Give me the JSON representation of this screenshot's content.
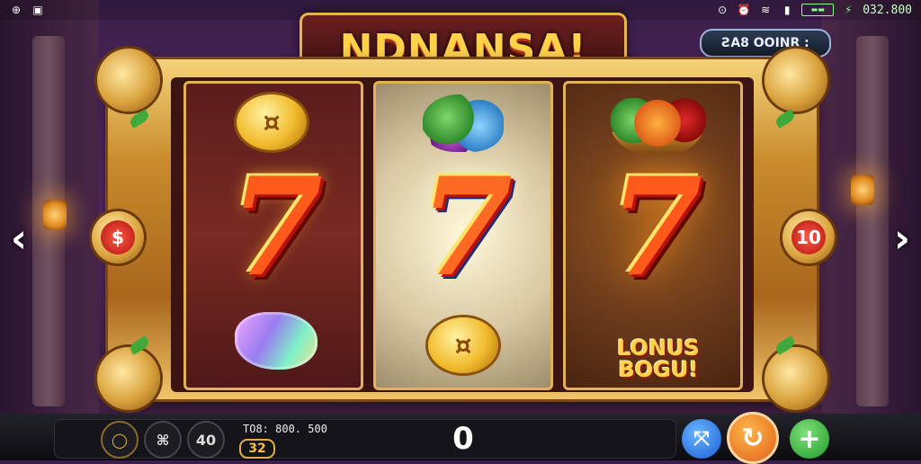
{
  "status_bar": {
    "left_icons": [
      "network-icon",
      "image-icon"
    ],
    "right_icons": [
      "record-icon",
      "alarm-icon",
      "wifi-icon",
      "signal-icon",
      "battery-icon",
      "charging-icon"
    ],
    "clock": "032.800"
  },
  "header": {
    "title": "NDNANSA!",
    "balance_pill": "ƧA8 OOINR :"
  },
  "reels": [
    {
      "top": "gold-coin-symbol",
      "middle": "7",
      "bottom": "candy-symbol"
    },
    {
      "top": "fruit-cluster-symbol",
      "middle": "7",
      "bottom": "gold-coin-symbol"
    },
    {
      "top": "fruit-basket-symbol",
      "middle": "7",
      "bottom": "bonus-symbol"
    }
  ],
  "bonus_text": "LONUS BOGU!",
  "side_buttons": {
    "left": "$",
    "right": "10"
  },
  "nav": {
    "prev": "‹",
    "next": "›"
  },
  "bottom_bar": {
    "btn_a": "◯",
    "btn_b": "⌘",
    "btn_c": "40",
    "bet_label": "TO8: 800. 500",
    "bet_value": "32",
    "win": "0",
    "auto_icon": "⤧",
    "spin_icon": "↻",
    "plus_icon": "+"
  },
  "colors": {
    "title_gold": "#ffd24a",
    "frame_gold": "#d9a13c",
    "seven_red": "#ff5a1c",
    "spin_orange": "#e0601a",
    "plus_green": "#1e9a2a",
    "auto_blue": "#1a5cd6"
  }
}
